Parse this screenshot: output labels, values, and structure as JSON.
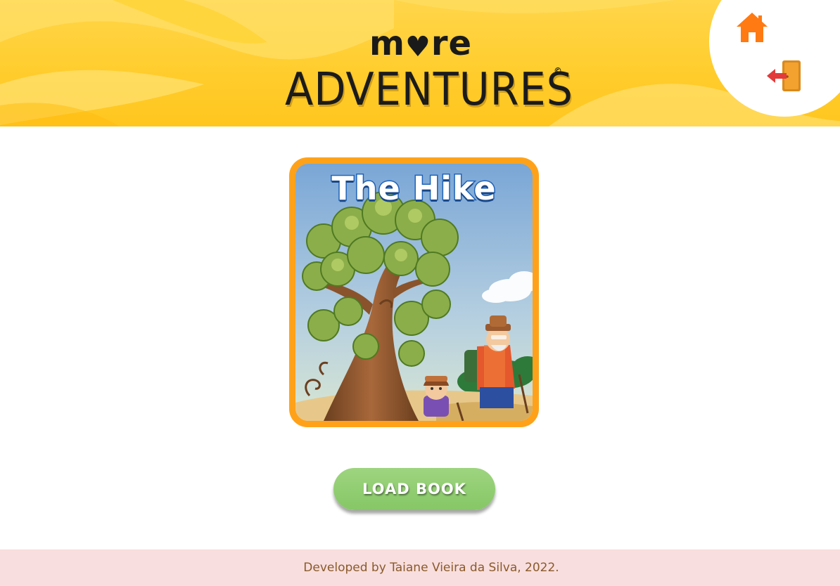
{
  "header": {
    "logo_top": "m",
    "logo_heart": "♥",
    "logo_top_end": "re",
    "logo_main": "ADVENTURES",
    "logo_mark": "©",
    "home_icon": "home-icon",
    "exit_icon": "exit-door-icon"
  },
  "book": {
    "title": "The Hike"
  },
  "actions": {
    "load_label": "LOAD BOOK"
  },
  "footer": {
    "text": "Developed by Taiane Vieira da Silva, 2022."
  },
  "colors": {
    "header_yellow": "#ffcd2e",
    "card_orange": "#ffa21a",
    "button_green": "#8fcb6f",
    "footer_pink": "#f8dede",
    "icon_orange": "#ff7a12",
    "exit_red": "#e23a3a"
  }
}
